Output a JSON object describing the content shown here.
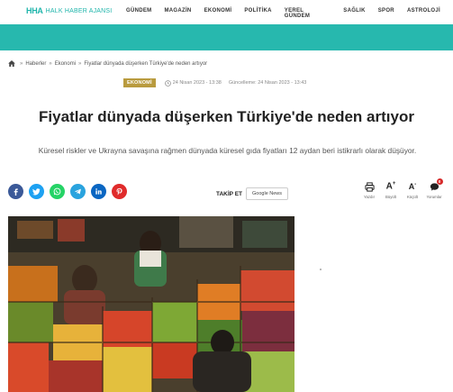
{
  "header": {
    "logo_mark": "HHA",
    "logo_text": "HALK HABER AJANSI",
    "nav": [
      "GÜNDEM",
      "MAGAZİN",
      "EKONOMİ",
      "POLİTİKA",
      "YEREL GÜNDEM",
      "SAĞLIK",
      "SPOR",
      "ASTROLOJİ"
    ],
    "accent": "#27b8ae"
  },
  "breadcrumb": {
    "items": [
      "Haberler",
      "Ekonomi",
      "Fiyatlar dünyada düşerken Türkiye'de neden artıyor"
    ],
    "separator": "»"
  },
  "meta": {
    "category": "EKONOMİ",
    "published": "24 Nisan 2023 - 13:38",
    "updated": "Güncelleme: 24 Nisan 2023 - 13:43"
  },
  "article": {
    "title": "Fiyatlar dünyada düşerken Türkiye'de neden artıyor",
    "subtitle": "Küresel riskler ve Ukrayna savaşına rağmen dünyada küresel gıda fiyatları 12 aydan beri istikrarlı olarak düşüyor."
  },
  "share": {
    "buttons": [
      {
        "name": "facebook-icon",
        "color": "#3b5998"
      },
      {
        "name": "twitter-icon",
        "color": "#1da1f2"
      },
      {
        "name": "whatsapp-icon",
        "color": "#25d366"
      },
      {
        "name": "telegram-icon",
        "color": "#2aa3de"
      },
      {
        "name": "linkedin-icon",
        "color": "#0a66c2"
      },
      {
        "name": "pinterest-icon",
        "color": "#e02b2b"
      }
    ],
    "follow_label": "TAKİP ET",
    "google_news": "Google News"
  },
  "tools": {
    "print": "Yazdır",
    "font_up": "Büyült",
    "font_down": "Küçült",
    "comments": "Yorumlar",
    "comment_count": "0"
  }
}
